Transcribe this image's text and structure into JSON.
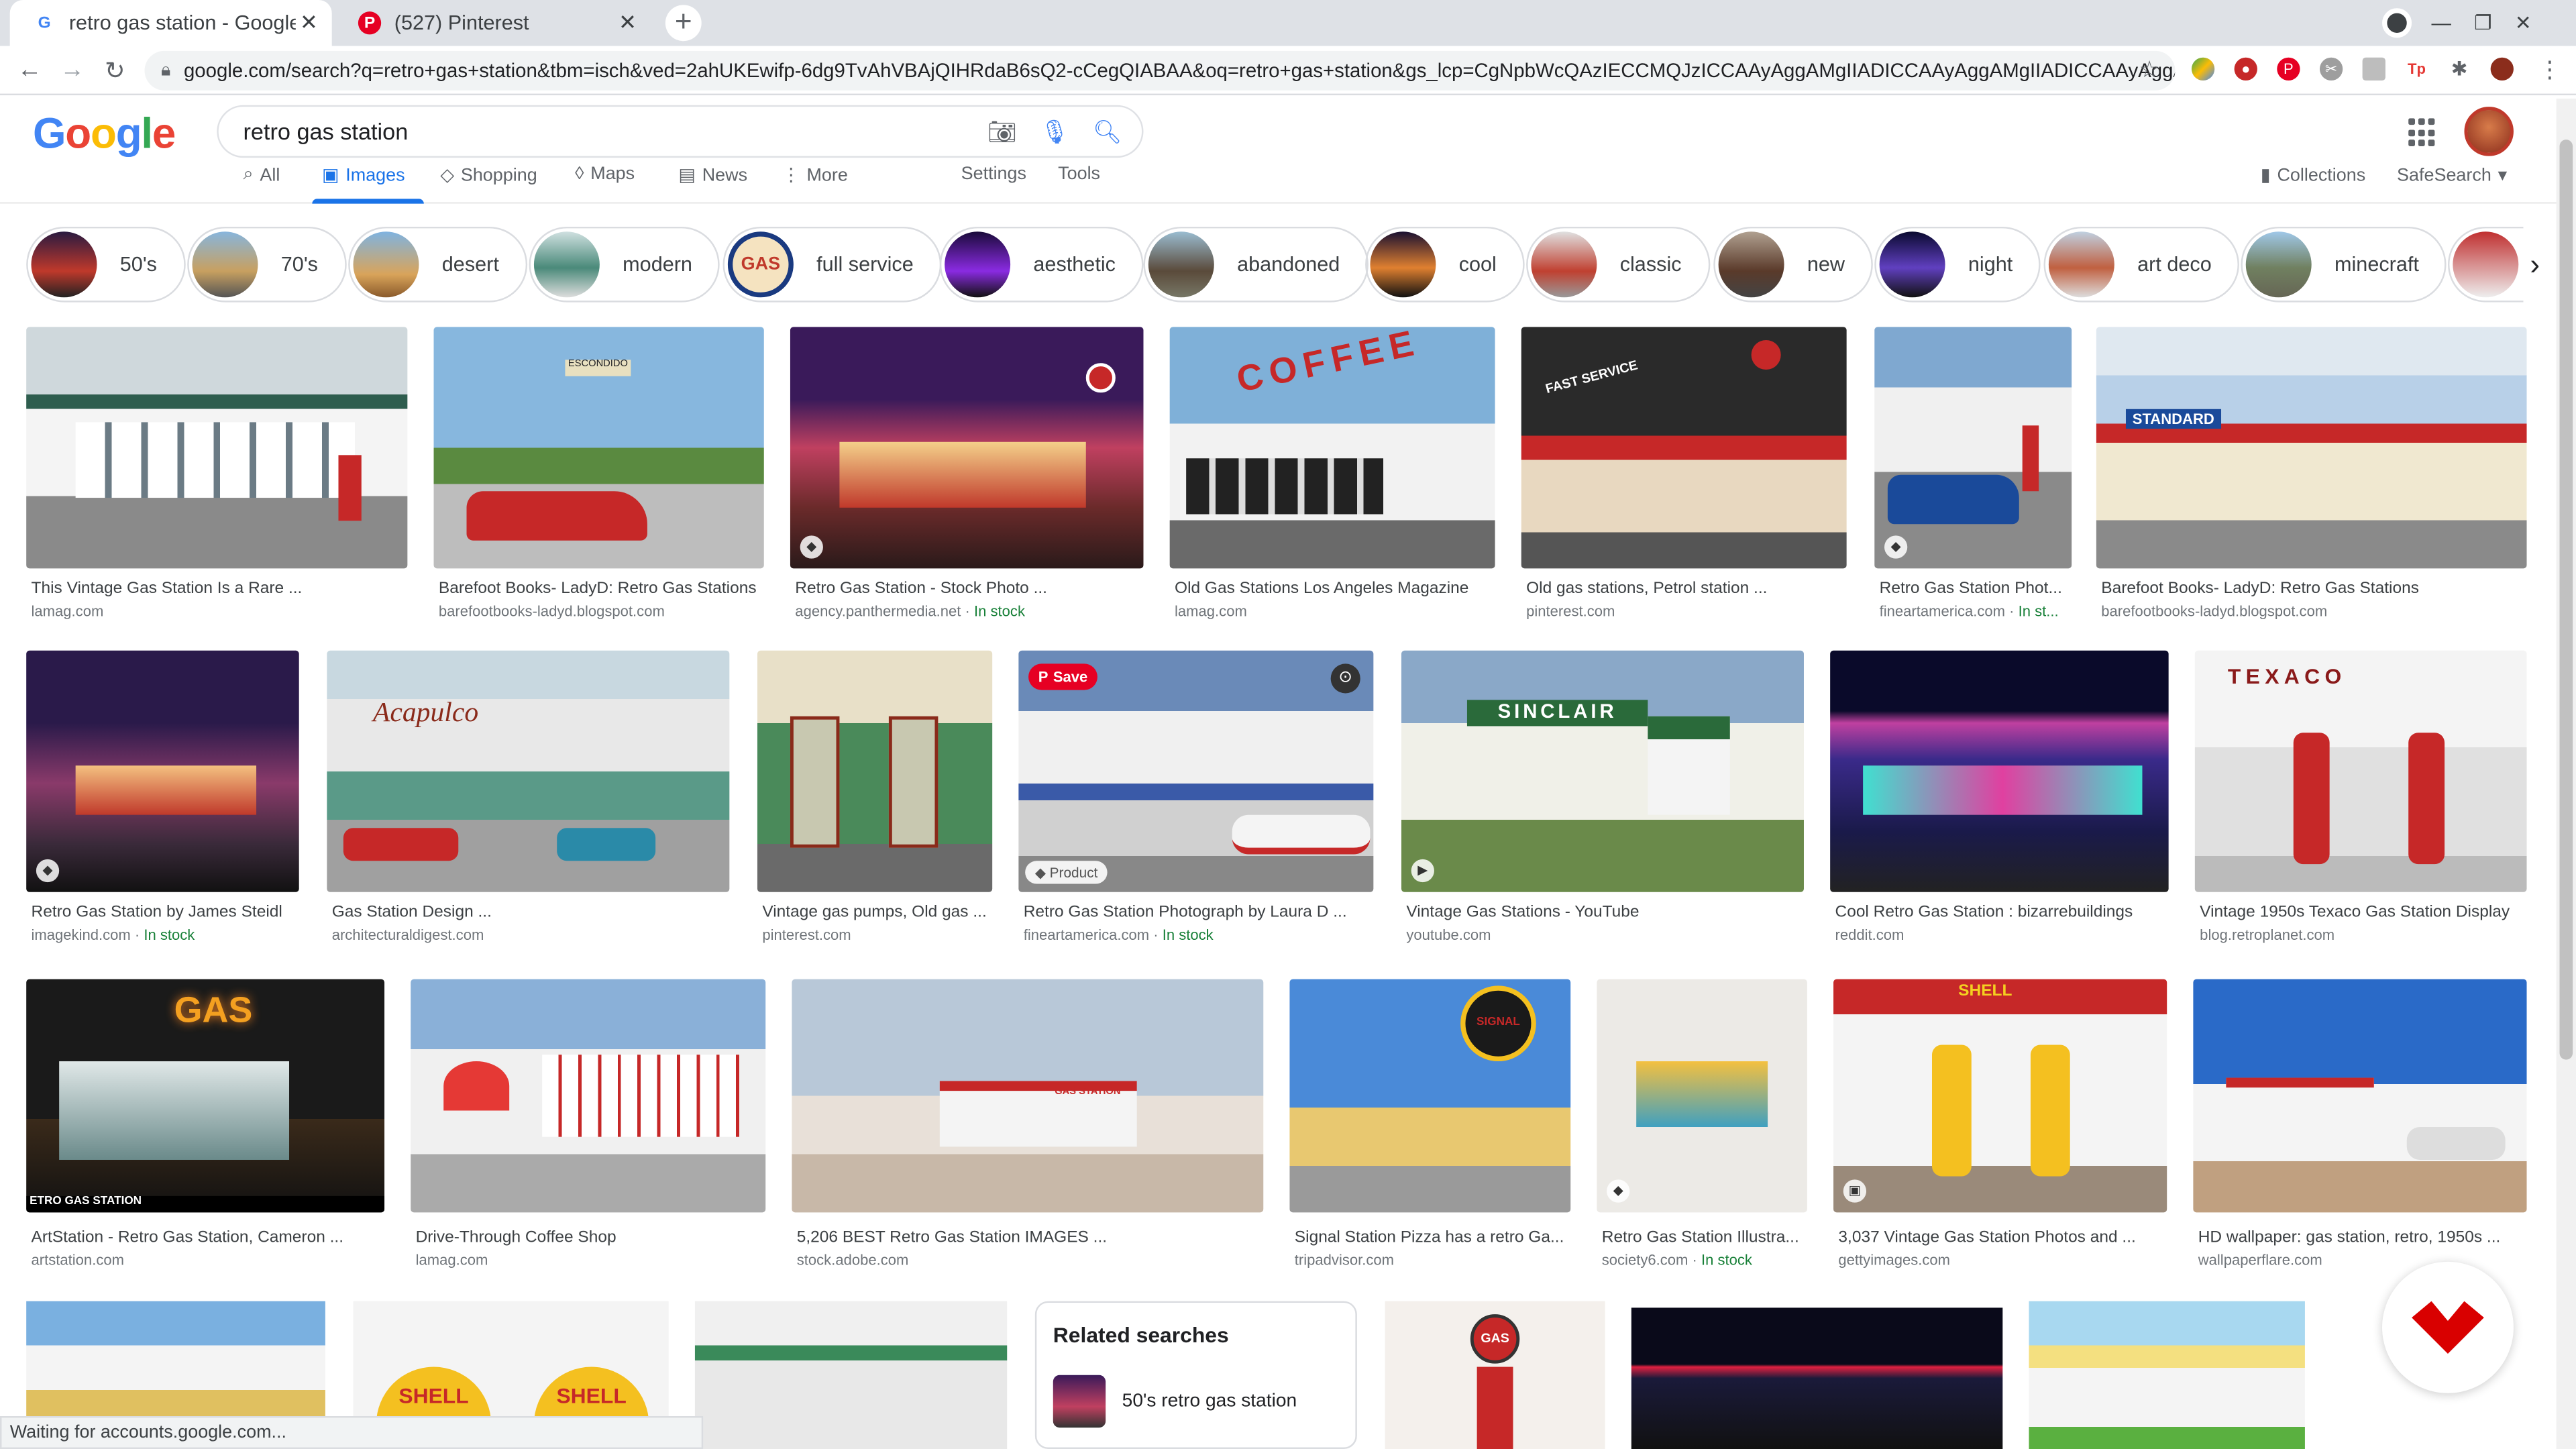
{
  "browser": {
    "tabs": [
      {
        "title": "retro gas station - Google",
        "icon": "google-g-icon"
      },
      {
        "title": "(527) Pinterest",
        "icon": "pinterest-icon"
      }
    ],
    "url": "google.com/search?q=retro+gas+station&tbm=isch&ved=2ahUKEwifp-6dg9TvAhVBAjQIHRdaB6sQ2-cCegQIABAA&oq=retro+gas+station&gs_lcp=CgNpbWcQAzIECCMQJzICCAAyAggAMgIIADICCAAyAggAMgIIADICCAAyAggAM..."
  },
  "google": {
    "logo": "Google",
    "query": "retro gas station",
    "nav_tabs": [
      "All",
      "Images",
      "Shopping",
      "Maps",
      "News",
      "More"
    ],
    "settings": "Settings",
    "tools": "Tools",
    "collections": "Collections",
    "safesearch": "SafeSearch"
  },
  "chips": [
    "50's",
    "70's",
    "desert",
    "modern",
    "full service",
    "aesthetic",
    "abandoned",
    "cool",
    "classic",
    "new",
    "night",
    "art deco",
    "minecraft"
  ],
  "results": [
    {
      "title": "This Vintage Gas Station Is a Rare ...",
      "source": "lamag.com",
      "stock": ""
    },
    {
      "title": "Barefoot Books- LadyD: Retro Gas Stations",
      "source": "barefootbooks-ladyd.blogspot.com",
      "stock": ""
    },
    {
      "title": "Retro Gas Station - Stock Photo ...",
      "source": "agency.panthermedia.net · ",
      "stock": "In stock"
    },
    {
      "title": "Old Gas Stations Los Angeles Magazine",
      "source": "lamag.com",
      "stock": ""
    },
    {
      "title": "Old gas stations, Petrol station ...",
      "source": "pinterest.com",
      "stock": ""
    },
    {
      "title": "Retro Gas Station Phot...",
      "source": "fineartamerica.com · ",
      "stock": "In st..."
    },
    {
      "title": "Barefoot Books- LadyD: Retro Gas Stations",
      "source": "barefootbooks-ladyd.blogspot.com",
      "stock": ""
    },
    {
      "title": "Retro Gas Station by James Steidl",
      "source": "imagekind.com · ",
      "stock": "In stock"
    },
    {
      "title": "Gas Station Design ...",
      "source": "architecturaldigest.com",
      "stock": ""
    },
    {
      "title": "Vintage gas pumps, Old gas ...",
      "source": "pinterest.com",
      "stock": ""
    },
    {
      "title": "Retro Gas Station Photograph by Laura D ...",
      "source": "fineartamerica.com · ",
      "stock": "In stock"
    },
    {
      "title": "Vintage Gas Stations - YouTube",
      "source": "youtube.com",
      "stock": ""
    },
    {
      "title": "Cool Retro Gas Station : bizarrebuildings",
      "source": "reddit.com",
      "stock": ""
    },
    {
      "title": "Vintage 1950s Texaco Gas Station Display",
      "source": "blog.retroplanet.com",
      "stock": ""
    },
    {
      "title": "ArtStation - Retro Gas Station, Cameron ...",
      "source": "artstation.com",
      "stock": ""
    },
    {
      "title": "Drive-Through Coffee Shop",
      "source": "lamag.com",
      "stock": ""
    },
    {
      "title": "5,206 BEST Retro Gas Station IMAGES ...",
      "source": "stock.adobe.com",
      "stock": ""
    },
    {
      "title": "Signal Station Pizza has a retro Ga...",
      "source": "tripadvisor.com",
      "stock": ""
    },
    {
      "title": "Retro Gas Station Illustra...",
      "source": "society6.com · ",
      "stock": "In stock"
    },
    {
      "title": "3,037 Vintage Gas Station Photos and ...",
      "source": "gettyimages.com",
      "stock": ""
    },
    {
      "title": "HD wallpaper: gas station, retro, 1950s ...",
      "source": "wallpaperflare.com",
      "stock": ""
    }
  ],
  "overlay": {
    "save": "Save",
    "product": "Product"
  },
  "image_text": {
    "escondido": "ESCONDIDO",
    "coffee": "COFFEE",
    "fast_service": "FAST SERVICE",
    "standard": "STANDARD",
    "acapulco": "Acapulco",
    "sinclair": "SINCLAIR",
    "texaco": "TEXACO",
    "gas": "GAS",
    "etro_gas_station": "ETRO GAS STATION",
    "gas_station": "GAS STATION",
    "shell": "SHELL",
    "shell_bottom": "SHELL",
    "signal": "SIGNAL",
    "gas_sign": "GAS"
  },
  "related": {
    "heading": "Related searches",
    "item": "50's retro gas station"
  },
  "status": "Waiting for accounts.google.com..."
}
